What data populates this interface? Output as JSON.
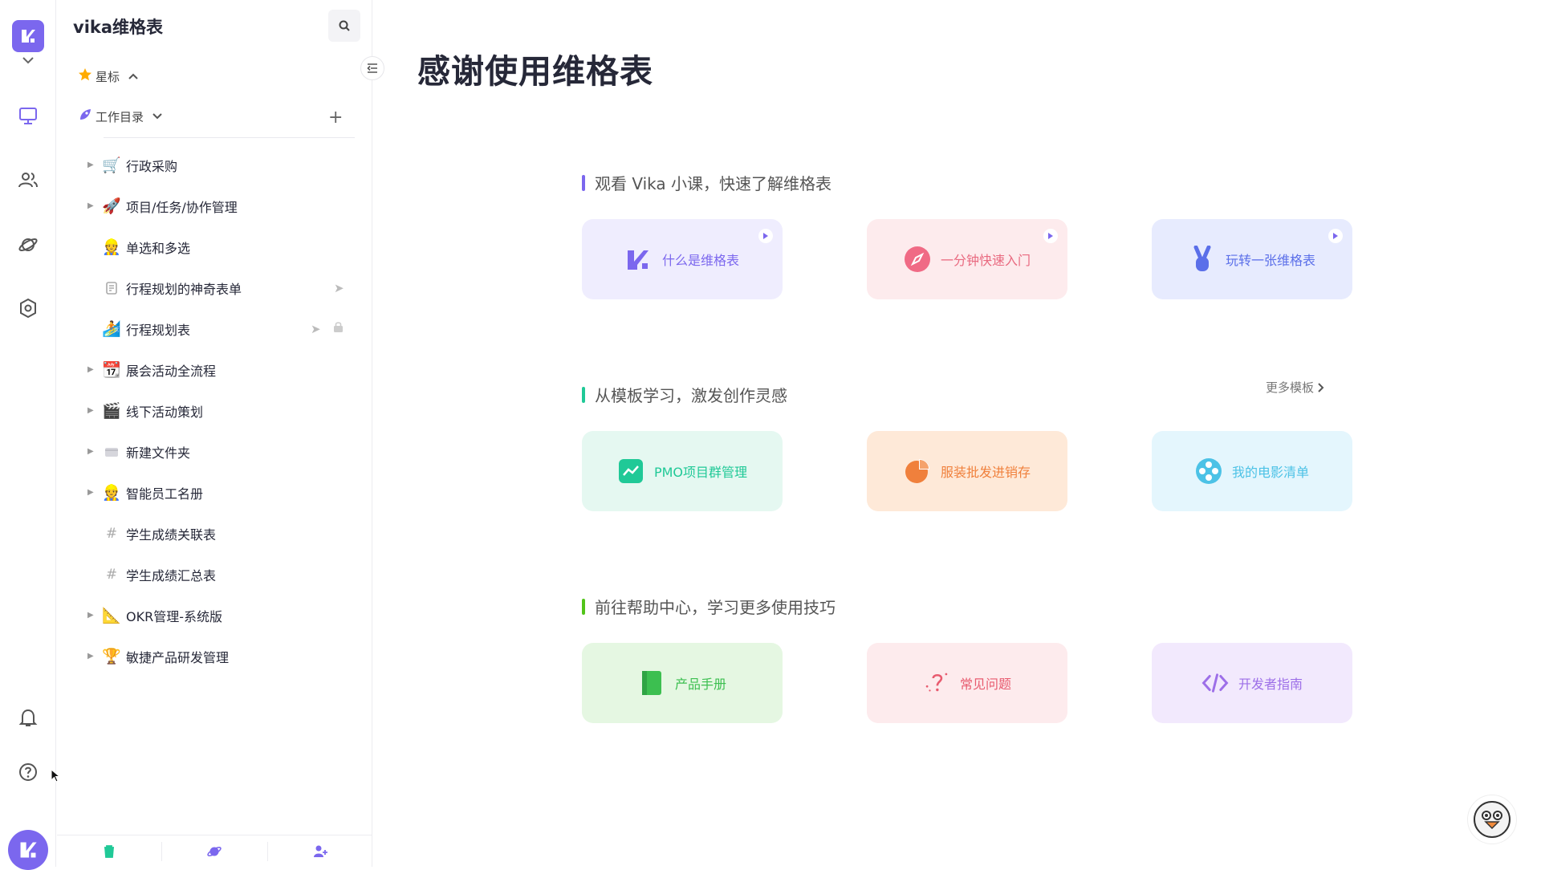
{
  "workspace": {
    "name": "vika维格表"
  },
  "sidebar": {
    "starred_label": "星标",
    "catalog_label": "工作目录",
    "tree": [
      {
        "label": "行政采购",
        "icon": "cart-icon",
        "emoji": "🛒",
        "expandable": true
      },
      {
        "label": "项目/任务/协作管理",
        "icon": "rocket-icon",
        "emoji": "🚀",
        "expandable": true
      },
      {
        "label": "单选和多选",
        "icon": "worker-icon",
        "emoji": "👷",
        "expandable": false
      },
      {
        "label": "行程规划的神奇表单",
        "icon": "form-icon",
        "emoji": "",
        "expandable": false,
        "shared": true
      },
      {
        "label": "行程规划表",
        "icon": "surfer-icon",
        "emoji": "🏄",
        "expandable": false,
        "shared": true,
        "locked": true
      },
      {
        "label": "展会活动全流程",
        "icon": "calendar-icon",
        "emoji": "📆",
        "expandable": true
      },
      {
        "label": "线下活动策划",
        "icon": "film-icon",
        "emoji": "🎬",
        "expandable": true
      },
      {
        "label": "新建文件夹",
        "icon": "folder-icon",
        "emoji": "",
        "expandable": true
      },
      {
        "label": "智能员工名册",
        "icon": "worker-icon",
        "emoji": "👷",
        "expandable": true
      },
      {
        "label": "学生成绩关联表",
        "icon": "grid-icon",
        "emoji": "#",
        "expandable": false
      },
      {
        "label": "学生成绩汇总表",
        "icon": "grid-icon",
        "emoji": "#",
        "expandable": false
      },
      {
        "label": "OKR管理-系统版",
        "icon": "ruler-icon",
        "emoji": "📐",
        "expandable": true
      },
      {
        "label": "敏捷产品研发管理",
        "icon": "trophy-icon",
        "emoji": "🏆",
        "expandable": true
      }
    ]
  },
  "main": {
    "title": "感谢使用维格表",
    "sections": [
      {
        "title": "观看 Vika 小课，快速了解维格表",
        "accent": "#7b67ee"
      },
      {
        "title": "从模板学习，激发创作灵感",
        "accent": "#20c997",
        "more": "更多模板"
      },
      {
        "title": "前往帮助中心，学习更多使用技巧",
        "accent": "#52c41a"
      }
    ],
    "cards": [
      {
        "label": "什么是维格表",
        "bg": "#efedfe",
        "color": "#7b67ee",
        "icon": "vika-logo-icon",
        "video": true
      },
      {
        "label": "一分钟快速入门",
        "bg": "#fdebed",
        "color": "#e96a80",
        "icon": "compass-icon",
        "video": true
      },
      {
        "label": "玩转一张维格表",
        "bg": "#e7ebfe",
        "color": "#5b6fe9",
        "icon": "peace-hand-icon",
        "video": true
      },
      {
        "label": "PMO项目群管理",
        "bg": "#e5f8f1",
        "color": "#20c997",
        "icon": "trend-chart-icon"
      },
      {
        "label": "服装批发进销存",
        "bg": "#fee9d8",
        "color": "#f0803c",
        "icon": "pie-chart-icon"
      },
      {
        "label": "我的电影清单",
        "bg": "#e4f6fd",
        "color": "#4cc2e6",
        "icon": "film-reel-icon"
      },
      {
        "label": "产品手册",
        "bg": "#e5f7e2",
        "color": "#3cbf50",
        "icon": "book-icon"
      },
      {
        "label": "常见问题",
        "bg": "#fdebed",
        "color": "#e85b6f",
        "icon": "question-icon"
      },
      {
        "label": "开发者指南",
        "bg": "#f2e9fd",
        "color": "#9d6fe8",
        "icon": "code-icon"
      }
    ]
  }
}
